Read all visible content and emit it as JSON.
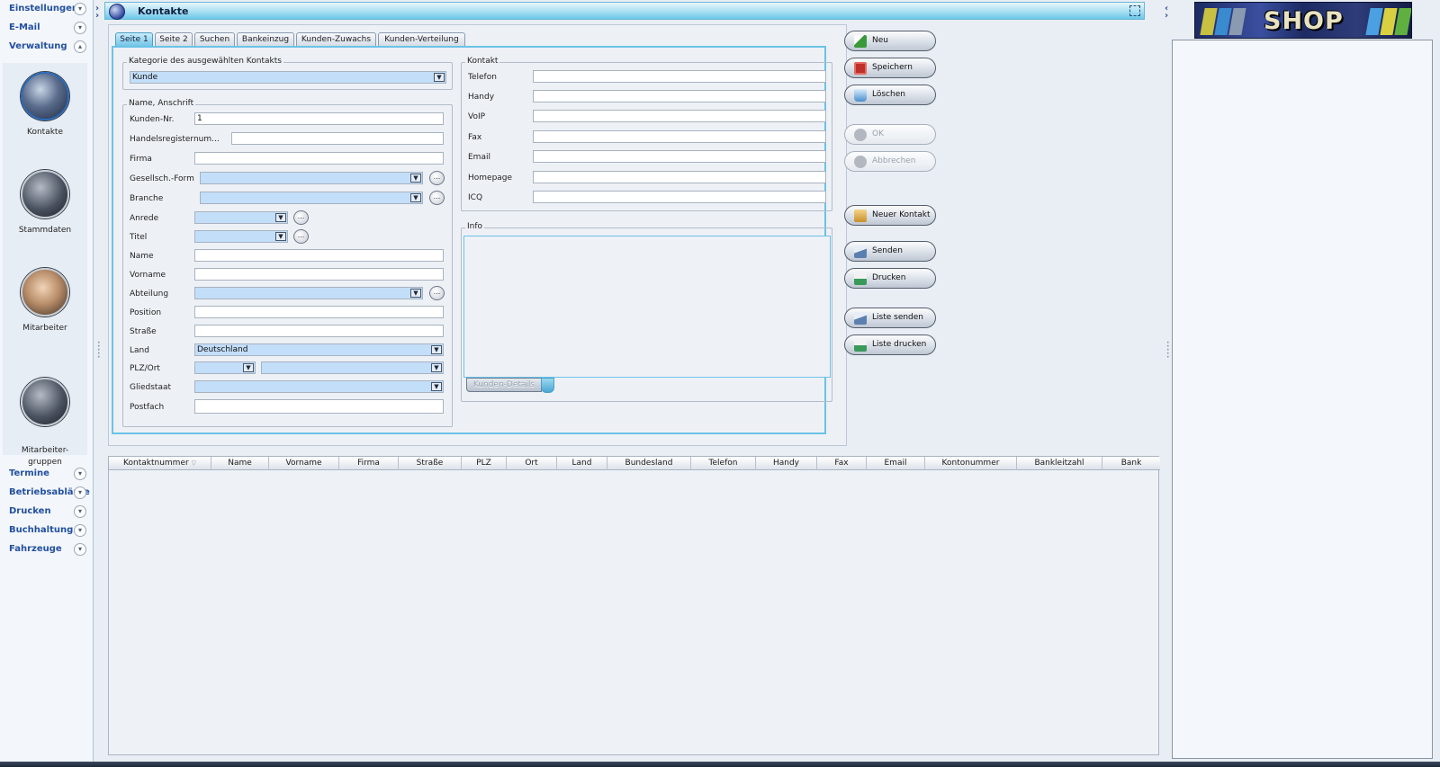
{
  "sidebar": {
    "headers": [
      {
        "label": "Einstellungen",
        "expanded": false
      },
      {
        "label": "E-Mail",
        "expanded": false
      },
      {
        "label": "Verwaltung",
        "expanded": true
      }
    ],
    "items": [
      {
        "label": "Kontakte"
      },
      {
        "label": "Stammdaten"
      },
      {
        "label": "Mitarbeiter"
      },
      {
        "label": "Mitarbeiter-\ngruppen"
      }
    ],
    "footer_headers": [
      {
        "label": "Termine"
      },
      {
        "label": "Betriebsabläufe"
      },
      {
        "label": "Drucken"
      },
      {
        "label": "Buchhaltung"
      },
      {
        "label": "Fahrzeuge"
      }
    ]
  },
  "window": {
    "title": "Kontakte"
  },
  "tabs": [
    "Seite 1",
    "Seite 2",
    "Suchen",
    "Bankeinzug",
    "Kunden-Zuwachs",
    "Kunden-Verteilung"
  ],
  "kategorie": {
    "legend": "Kategorie des ausgewählten Kontakts",
    "value": "Kunde"
  },
  "anschrift": {
    "legend": "Name, Anschrift",
    "fields": {
      "kunden_nr": {
        "label": "Kunden-Nr.",
        "value": "1"
      },
      "handelsregister": {
        "label": "Handelsregisternum...",
        "value": ""
      },
      "firma": {
        "label": "Firma",
        "value": ""
      },
      "gesellsch": {
        "label": "Gesellsch.-Form",
        "value": ""
      },
      "branche": {
        "label": "Branche",
        "value": ""
      },
      "anrede": {
        "label": "Anrede",
        "value": ""
      },
      "titel": {
        "label": "Titel",
        "value": ""
      },
      "name": {
        "label": "Name",
        "value": ""
      },
      "vorname": {
        "label": "Vorname",
        "value": ""
      },
      "abteilung": {
        "label": "Abteilung",
        "value": ""
      },
      "position": {
        "label": "Position",
        "value": ""
      },
      "strasse": {
        "label": "Straße",
        "value": ""
      },
      "land": {
        "label": "Land",
        "value": "Deutschland"
      },
      "plzort": {
        "label": "PLZ/Ort",
        "value": ""
      },
      "gliedstaat": {
        "label": "Gliedstaat",
        "value": ""
      },
      "postfach": {
        "label": "Postfach",
        "value": ""
      }
    }
  },
  "kontakt": {
    "legend": "Kontakt",
    "fields": [
      {
        "label": "Telefon",
        "value": ""
      },
      {
        "label": "Handy",
        "value": ""
      },
      {
        "label": "VoIP",
        "value": ""
      },
      {
        "label": "Fax",
        "value": ""
      },
      {
        "label": "Email",
        "value": ""
      },
      {
        "label": "Homepage",
        "value": ""
      },
      {
        "label": "ICQ",
        "value": ""
      }
    ]
  },
  "info": {
    "legend": "Info",
    "details_label": "Kunden-Details"
  },
  "more_glyph": "...",
  "dropdown_glyph": "▼",
  "actions": [
    {
      "label": "Neu",
      "enabled": true,
      "icon": "new-icon",
      "color": "#3a9a3a"
    },
    {
      "label": "Speichern",
      "enabled": true,
      "icon": "save-icon",
      "color": "#c0302a"
    },
    {
      "label": "Löschen",
      "enabled": true,
      "icon": "trash-icon",
      "color": "#4a8fd0"
    },
    {
      "label": "OK",
      "enabled": false,
      "icon": "check-icon",
      "color": "#b3b8c0"
    },
    {
      "label": "Abbrechen",
      "enabled": false,
      "icon": "cancel-icon",
      "color": "#b3b8c0"
    },
    {
      "label": "Neuer Kontakt",
      "enabled": true,
      "icon": "contact-card-icon",
      "color": "#c8902a"
    },
    {
      "label": "Senden",
      "enabled": true,
      "icon": "mail-icon",
      "color": "#5a7fb0"
    },
    {
      "label": "Drucken",
      "enabled": true,
      "icon": "printer-icon",
      "color": "#3a9a5a"
    },
    {
      "label": "Liste senden",
      "enabled": true,
      "icon": "mail-list-icon",
      "color": "#5a7fb0"
    },
    {
      "label": "Liste drucken",
      "enabled": true,
      "icon": "printer-list-icon",
      "color": "#3a9a5a"
    }
  ],
  "grid": {
    "columns": [
      "Kontaktnummer",
      "Name",
      "Vorname",
      "Firma",
      "Straße",
      "PLZ",
      "Ort",
      "Land",
      "Bundesland",
      "Telefon",
      "Handy",
      "Fax",
      "Email",
      "Kontonummer",
      "Bankleitzahl",
      "Bank"
    ],
    "sorted_column": "Kontaktnummer",
    "rows": []
  },
  "shop": {
    "label": "SHOP"
  },
  "colors": {
    "accent": "#6cc2e6",
    "nav_text": "#2250a0",
    "select_bg": "#c3def8"
  }
}
